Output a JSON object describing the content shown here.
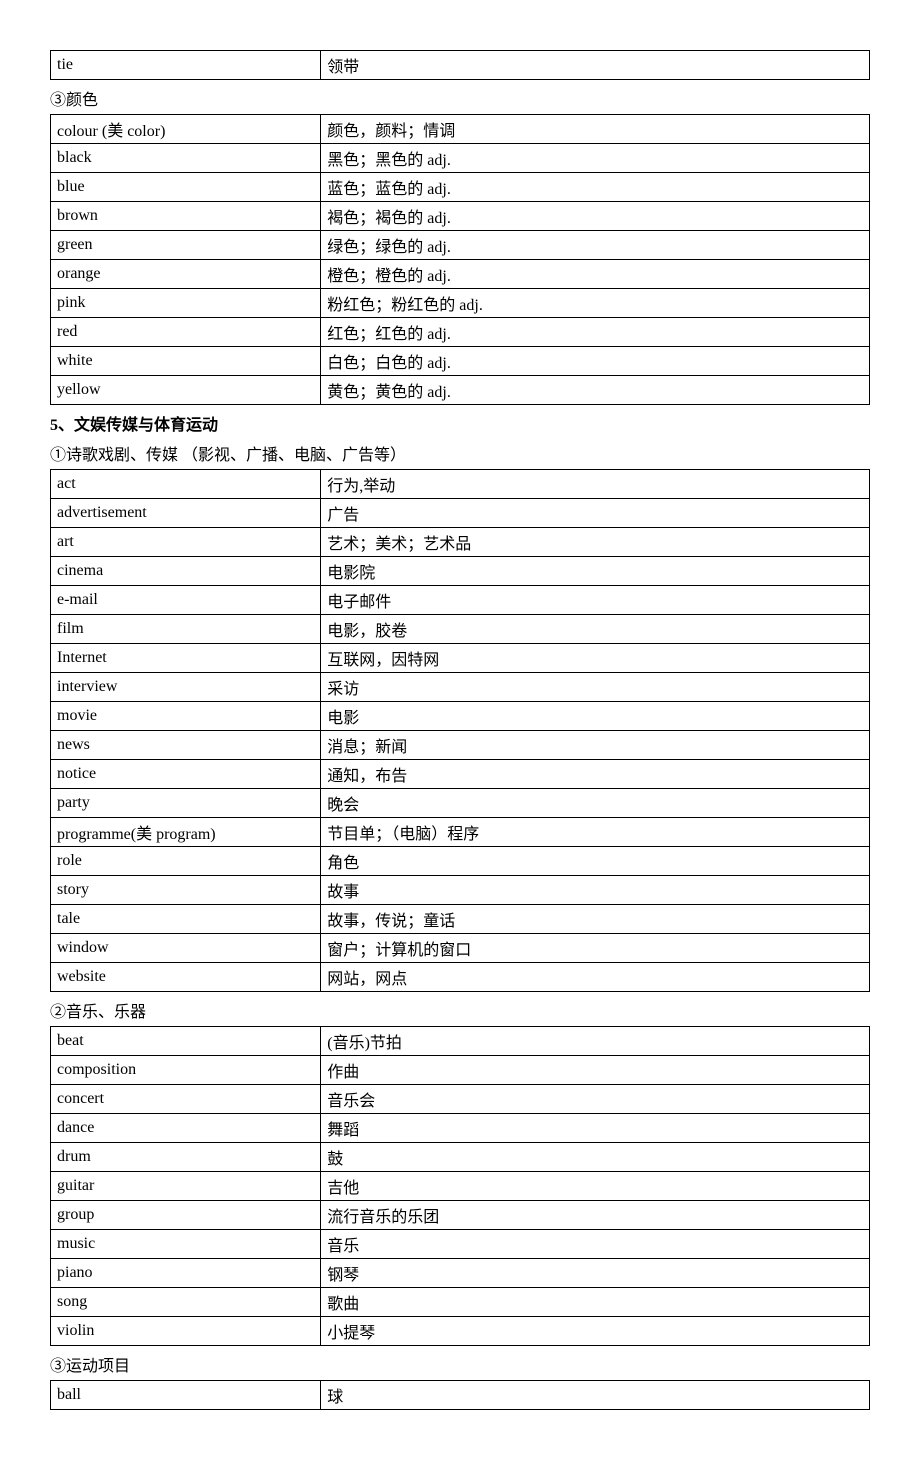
{
  "table0": [
    {
      "en": "tie",
      "zh": "领带"
    }
  ],
  "sub3": "③颜色",
  "table1": [
    {
      "en": "colour (美  color)",
      "zh": "颜色，颜料；情调"
    },
    {
      "en": "black",
      "zh": "黑色；黑色的 adj."
    },
    {
      "en": "blue",
      "zh": "蓝色；蓝色的 adj."
    },
    {
      "en": "brown",
      "zh": "褐色；褐色的 adj."
    },
    {
      "en": "green",
      "zh": "绿色；绿色的 adj."
    },
    {
      "en": "orange",
      "zh": "橙色；橙色的 adj."
    },
    {
      "en": "pink",
      "zh": "粉红色；粉红色的 adj."
    },
    {
      "en": "red",
      "zh": "红色；红色的 adj."
    },
    {
      "en": "white",
      "zh": "白色；白色的 adj."
    },
    {
      "en": "yellow",
      "zh": "黄色；黄色的 adj."
    }
  ],
  "section5": "5、文娱传媒与体育运动",
  "sub5_1": "①诗歌戏剧、传媒 （影视、广播、电脑、广告等）",
  "table2": [
    {
      "en": "act",
      "zh": "行为,举动"
    },
    {
      "en": "advertisement",
      "zh": "广告"
    },
    {
      "en": "art",
      "zh": "艺术；美术；艺术品"
    },
    {
      "en": "cinema",
      "zh": "电影院"
    },
    {
      "en": "e-mail",
      "zh": "电子邮件"
    },
    {
      "en": "film",
      "zh": "电影，胶卷"
    },
    {
      "en": "Internet",
      "zh": "互联网，因特网"
    },
    {
      "en": "interview",
      "zh": "采访"
    },
    {
      "en": "movie",
      "zh": "电影"
    },
    {
      "en": "news",
      "zh": "消息；新闻"
    },
    {
      "en": "notice",
      "zh": "通知，布告"
    },
    {
      "en": "party",
      "zh": "晚会"
    },
    {
      "en": "programme(美 program)",
      "zh": "节目单；（电脑）程序"
    },
    {
      "en": "role",
      "zh": "角色"
    },
    {
      "en": "story",
      "zh": "故事"
    },
    {
      "en": "tale",
      "zh": "故事，传说；童话"
    },
    {
      "en": "window",
      "zh": "窗户；计算机的窗口"
    },
    {
      "en": "website",
      "zh": "网站，网点"
    }
  ],
  "sub5_2": "②音乐、乐器",
  "table3": [
    {
      "en": "beat",
      "zh": "(音乐)节拍"
    },
    {
      "en": "composition",
      "zh": "作曲"
    },
    {
      "en": "concert",
      "zh": "音乐会"
    },
    {
      "en": "dance",
      "zh": "舞蹈"
    },
    {
      "en": "drum",
      "zh": "鼓"
    },
    {
      "en": "guitar",
      "zh": "吉他"
    },
    {
      "en": "group",
      "zh": "流行音乐的乐团"
    },
    {
      "en": "music",
      "zh": "音乐"
    },
    {
      "en": "piano",
      "zh": "钢琴"
    },
    {
      "en": "song",
      "zh": "歌曲"
    },
    {
      "en": "violin",
      "zh": "小提琴"
    }
  ],
  "sub5_3": "③运动项目",
  "table4": [
    {
      "en": "ball",
      "zh": "球"
    }
  ]
}
